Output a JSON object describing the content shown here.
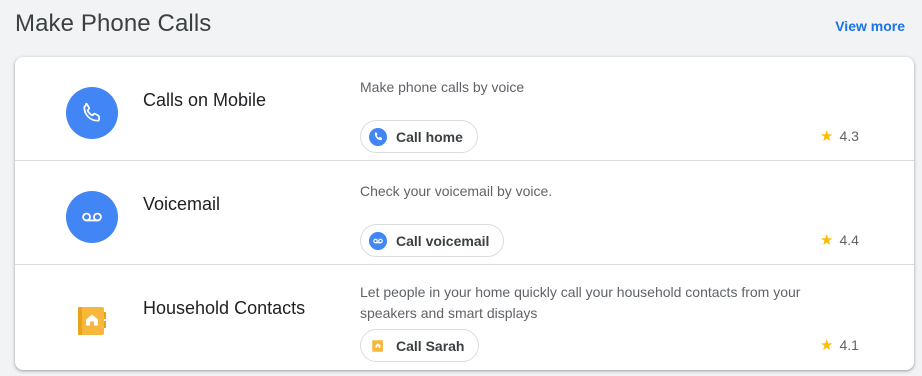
{
  "section": {
    "title": "Make Phone Calls",
    "view_more": "View more"
  },
  "actions": [
    {
      "title": "Calls on Mobile",
      "description": "Make phone calls by voice",
      "chip": "Call home",
      "rating": "4.3",
      "icon": "phone-icon"
    },
    {
      "title": "Voicemail",
      "description": "Check your voicemail by voice.",
      "chip": "Call voicemail",
      "rating": "4.4",
      "icon": "voicemail-icon"
    },
    {
      "title": "Household Contacts",
      "description": "Let people in your home quickly call your household contacts from your speakers and smart displays",
      "chip": "Call Sarah",
      "rating": "4.1",
      "icon": "contacts-book-icon"
    }
  ],
  "colors": {
    "accent": "#1a73e8",
    "icon_blue": "#4285f4",
    "star": "#fbbc04",
    "contacts_yellow": "#f6b73c"
  }
}
